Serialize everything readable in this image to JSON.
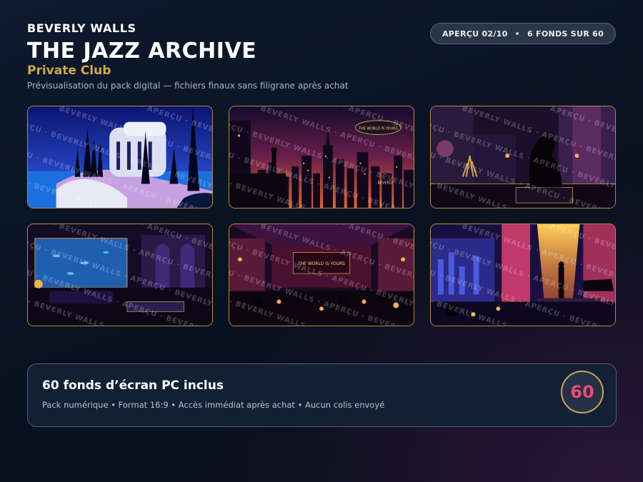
{
  "header": {
    "brand": "BEVERLY WALLS",
    "title": "THE JAZZ ARCHIVE",
    "subtitle": "Private Club",
    "tagline": "Prévisualisation du pack digital  —  fichiers finaux sans filigrane après achat",
    "preview_label": "APERÇU 02/10",
    "preview_sep": "•",
    "preview_count": "6 FONDS SUR 60"
  },
  "gallery": {
    "watermark": "APERÇU · BEVERLY WALLS · APERÇU · BEVERLY WALLS · APERÇU · BEVERLY WALLS",
    "items": [
      {
        "scene": "art-deco-villa-by-the-sea"
      },
      {
        "scene": "city-skyline-with-blimp",
        "blimp_text": "THE WORLD IS YOURS",
        "sign_text": "BEVERLY"
      },
      {
        "scene": "black-panther-statue-lounge"
      },
      {
        "scene": "aquarium-lounge"
      },
      {
        "scene": "nightclub-interior",
        "sign_text": "THE WORLD IS YOURS"
      },
      {
        "scene": "jazz-stage-saxophonist"
      }
    ]
  },
  "info": {
    "title": "60 fonds d’écran PC inclus",
    "meta": "Pack numérique • Format 16:9 • Accès immédiat après achat • Aucun colis envoyé",
    "badge": "60"
  },
  "colors": {
    "accent_gold": "#d4a84b",
    "badge_pink": "#e84d75",
    "background": "#08111f"
  }
}
